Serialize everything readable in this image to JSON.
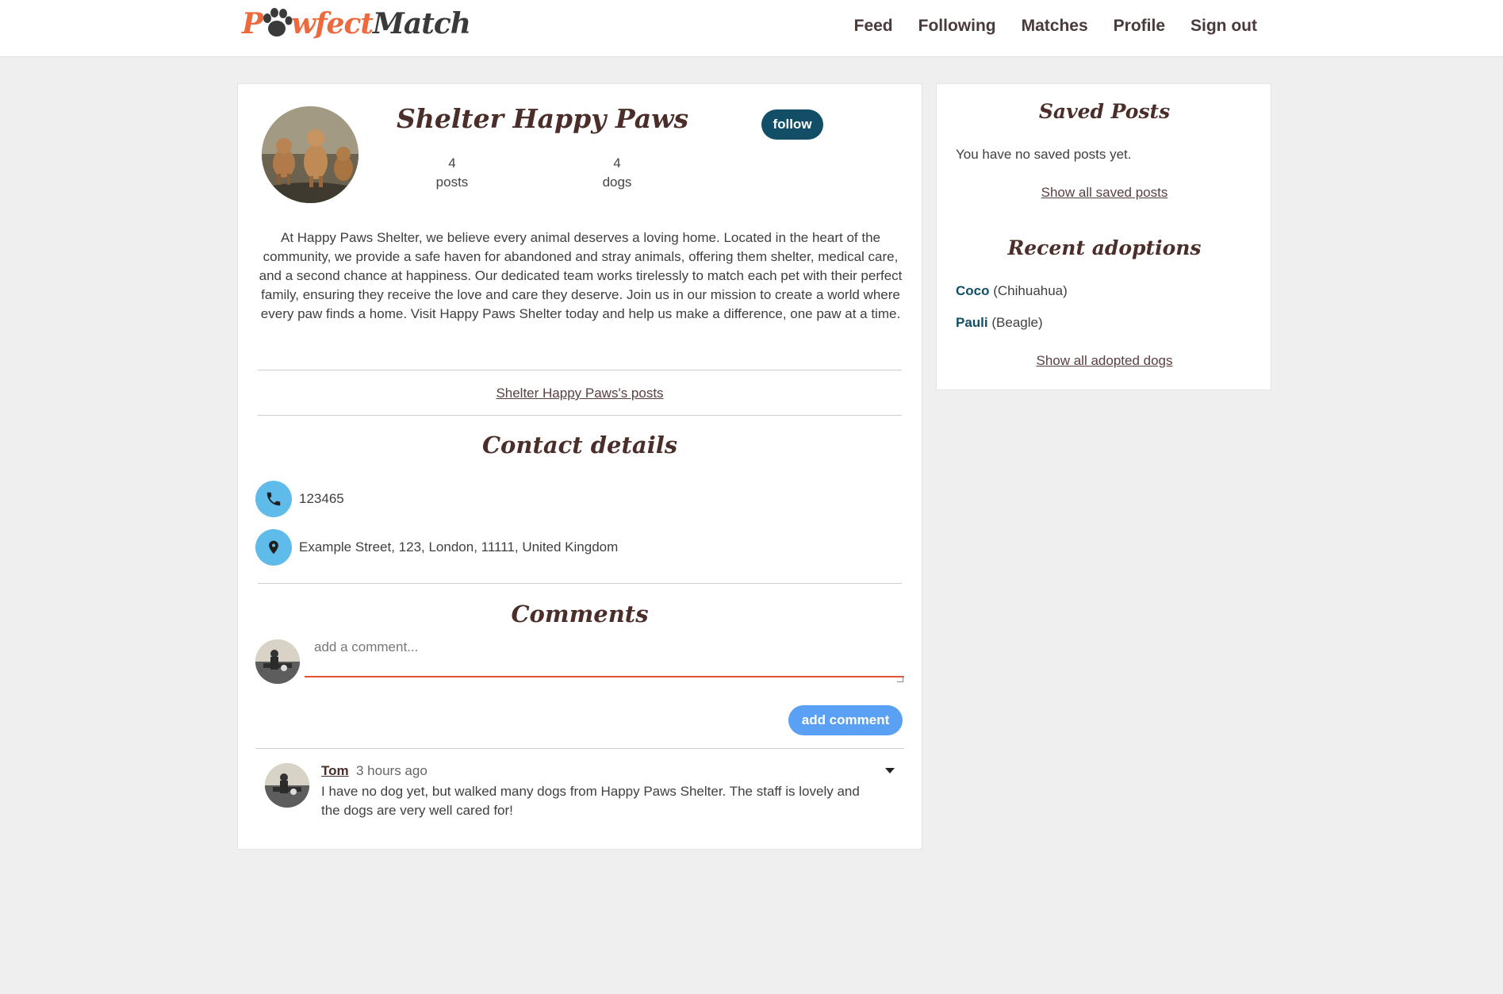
{
  "header": {
    "logo_p": "P",
    "logo_wfect": "wfect",
    "logo_match": "Match",
    "nav": [
      {
        "label": "Feed"
      },
      {
        "label": "Following"
      },
      {
        "label": "Matches"
      },
      {
        "label": "Profile"
      },
      {
        "label": "Sign out"
      }
    ]
  },
  "profile": {
    "name": "Shelter Happy Paws",
    "follow_label": "follow",
    "stats": [
      {
        "value": "4",
        "label": "posts"
      },
      {
        "value": "4",
        "label": "dogs"
      }
    ],
    "bio": "At Happy Paws Shelter, we believe every animal deserves a loving home. Located in the heart of the community, we provide a safe haven for abandoned and stray animals, offering them shelter, medical care, and a second chance at happiness. Our dedicated team works tirelessly to match each pet with their perfect family, ensuring they receive the love and care they deserve. Join us in our mission to create a world where every paw finds a home. Visit Happy Paws Shelter today and help us make a difference, one paw at a time.",
    "posts_link": "Shelter Happy Paws's posts"
  },
  "contact": {
    "title": "Contact details",
    "phone": "123465",
    "address": "Example Street, 123, London, 11111, United Kingdom",
    "phone_icon": "phone-icon",
    "location_icon": "location-pin-icon"
  },
  "comments": {
    "title": "Comments",
    "placeholder": "add a comment...",
    "add_label": "add comment",
    "items": [
      {
        "author": "Tom",
        "time": "3 hours ago",
        "text": "I have no dog yet, but walked many dogs from Happy Paws Shelter. The staff is lovely and the dogs are very well cared for!"
      }
    ]
  },
  "sidebar": {
    "saved_title": "Saved Posts",
    "saved_empty": "You have no saved posts yet.",
    "saved_link": "Show all saved posts",
    "adoptions_title": "Recent adoptions",
    "adoptions": [
      {
        "name": "Coco",
        "breed": "(Chihuahua)"
      },
      {
        "name": "Pauli",
        "breed": "(Beagle)"
      }
    ],
    "adoptions_link": "Show all adopted dogs"
  },
  "colors": {
    "brand_orange": "#ec6a3d",
    "brand_dark": "#4b2e2a",
    "follow_bg": "#124e66",
    "contact_icon_bg": "#5fbcea",
    "add_comment_bg": "#5aa0f5"
  }
}
